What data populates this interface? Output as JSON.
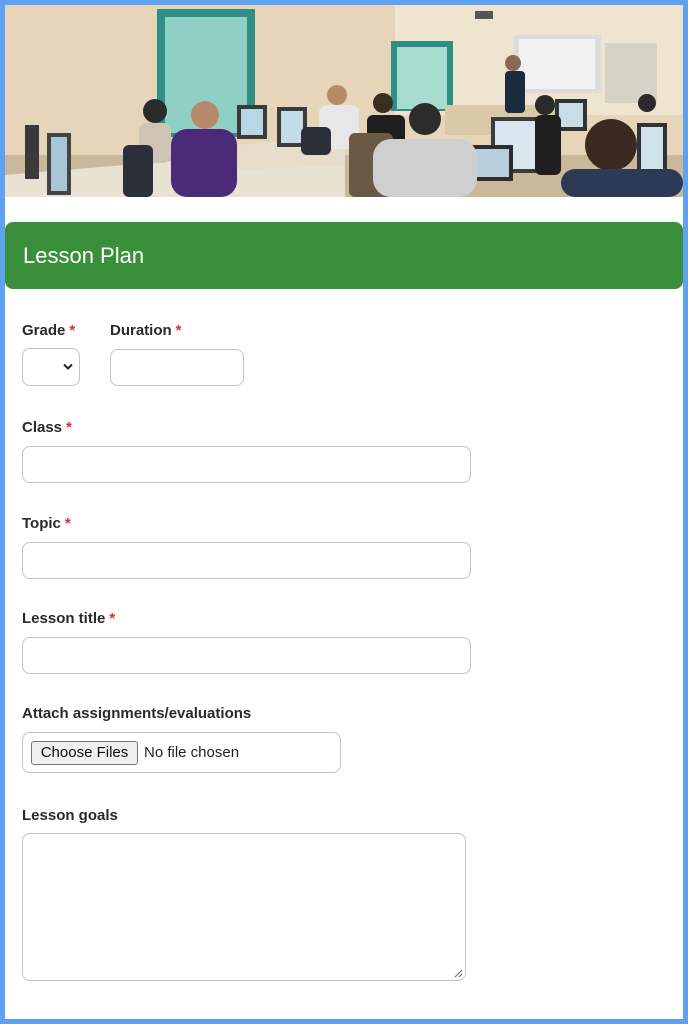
{
  "banner": {
    "title": "Lesson Plan"
  },
  "form": {
    "grade": {
      "label": "Grade",
      "required_mark": "*",
      "value": ""
    },
    "duration": {
      "label": "Duration",
      "required_mark": "*",
      "value": ""
    },
    "class": {
      "label": "Class",
      "required_mark": "*",
      "value": ""
    },
    "topic": {
      "label": "Topic",
      "required_mark": "*",
      "value": ""
    },
    "lesson_title": {
      "label": "Lesson title",
      "required_mark": "*",
      "value": ""
    },
    "attach": {
      "label": "Attach assignments/evaluations",
      "button": "Choose Files",
      "status": "No file chosen"
    },
    "goals": {
      "label": "Lesson goals",
      "value": ""
    }
  },
  "colors": {
    "banner": "#3a8f3b",
    "border": "#5ea1f0",
    "required": "#d93025"
  },
  "icons": {
    "select_arrow": "chevron-down-icon"
  }
}
